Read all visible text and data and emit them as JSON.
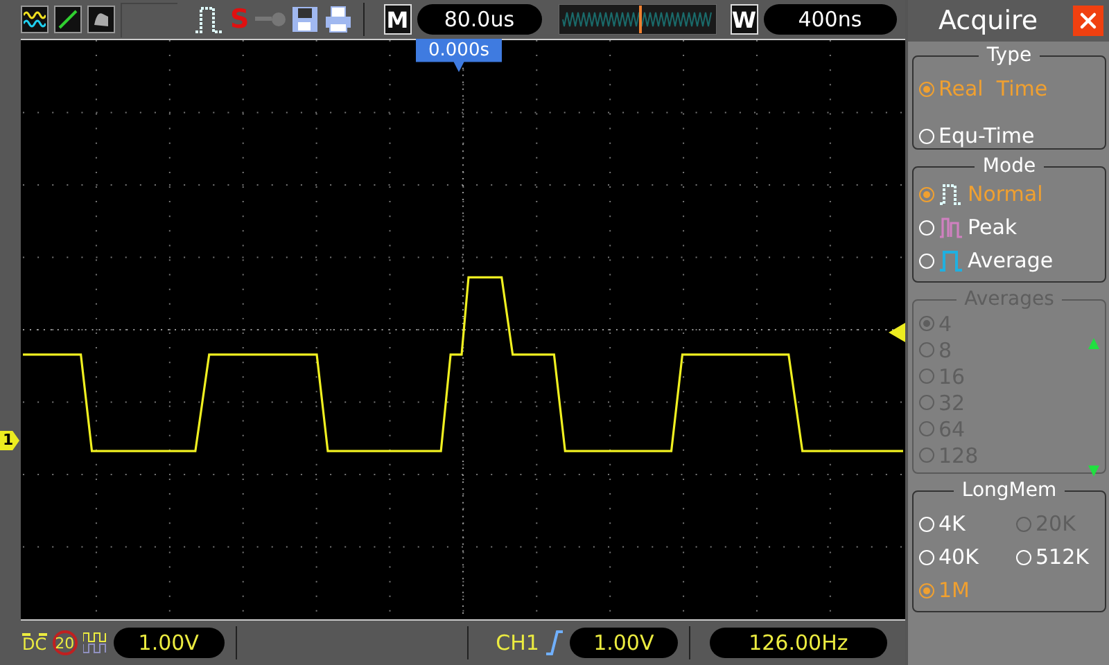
{
  "top_bar": {
    "stop_label": "S",
    "zoom_key": "M",
    "timebase": "80.0us",
    "window_key": "W",
    "window_timebase": "400ns"
  },
  "screen": {
    "trigger_position": "0.000s",
    "channel_marker": "1"
  },
  "panel": {
    "title": "Acquire",
    "type": {
      "title": "Type",
      "options": [
        {
          "label": "Real  Time",
          "selected": true
        },
        {
          "label": "Equ-Time",
          "selected": false
        }
      ]
    },
    "mode": {
      "title": "Mode",
      "options": [
        {
          "kind": "normal",
          "label": "Normal",
          "selected": true
        },
        {
          "kind": "peak",
          "label": "Peak",
          "selected": false
        },
        {
          "kind": "average",
          "label": "Average",
          "selected": false
        }
      ]
    },
    "averages": {
      "title": "Averages",
      "disabled": true,
      "options": [
        {
          "label": "4",
          "selected": true
        },
        {
          "label": "8",
          "selected": false
        },
        {
          "label": "16",
          "selected": false
        },
        {
          "label": "32",
          "selected": false
        },
        {
          "label": "64",
          "selected": false
        },
        {
          "label": "128",
          "selected": false
        }
      ]
    },
    "long_mem": {
      "title": "LongMem",
      "options": [
        {
          "label": "4K",
          "selected": false,
          "disabled": false
        },
        {
          "label": "20K",
          "selected": false,
          "disabled": true
        },
        {
          "label": "40K",
          "selected": false,
          "disabled": false
        },
        {
          "label": "512K",
          "selected": false,
          "disabled": false
        },
        {
          "label": "1M",
          "selected": true,
          "disabled": false
        }
      ]
    }
  },
  "bottom_bar": {
    "coupling": "DC",
    "bandwidth_limit": "20",
    "volts_per_div": "1.00V",
    "trigger_source": "CH1",
    "trigger_level": "1.00V",
    "frequency": "126.00Hz"
  }
}
